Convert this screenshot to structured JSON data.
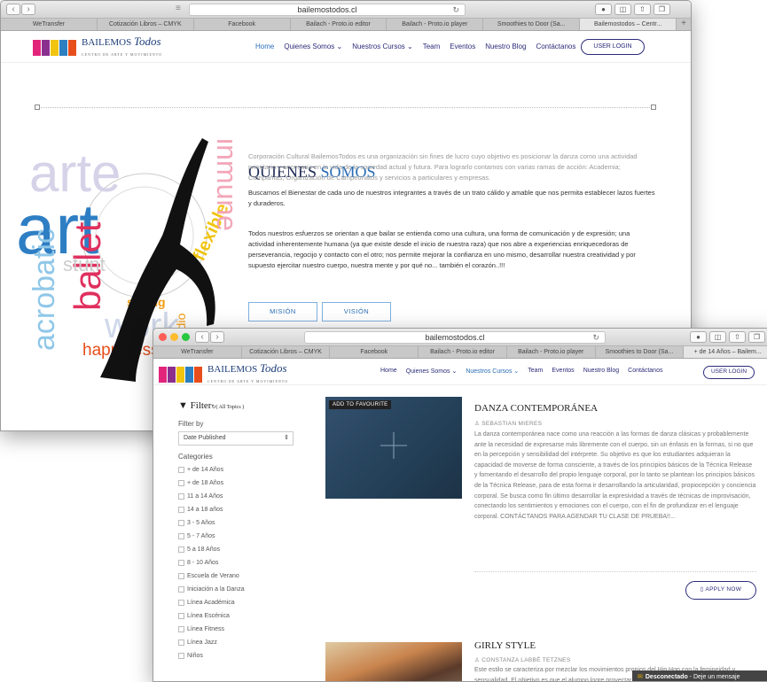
{
  "browser": {
    "url": "bailemostodos.cl",
    "tabs_w1": [
      "WeTransfer",
      "Cotización Libros – CMYK",
      "Facebook",
      "Bailach - Proto.io editor",
      "Bailach - Proto.io player",
      "Smoothies to Door (Sa...",
      "Bailemostodos – Centr..."
    ],
    "tabs_w2": [
      "WeTransfer",
      "Cotización Libros – CMYK",
      "Facebook",
      "Bailach - Proto.io editor",
      "Bailach - Proto.io player",
      "Smoothies to Door (Sa...",
      "+ de 14 Años – Bailem..."
    ]
  },
  "site": {
    "brand": "BAILEMOS",
    "brand_script": "Todos",
    "brand_sub": "CENTRO DE ARTE Y MOVIMIENTO",
    "menu": [
      "Home",
      "Quienes Somos",
      "Nuestros Cursos",
      "Team",
      "Eventos",
      "Nuestro Blog",
      "Contáctanos"
    ],
    "login": "USER LOGIN",
    "colors": {
      "navy": "#2b2b7a",
      "accent": "#2a6db5"
    }
  },
  "about": {
    "title_a": "QUIENES ",
    "title_b": "SOMOS",
    "p1": "Corporación Cultural BailemosTodos es una organización sin fines de lucro cuyo objetivo es posicionar la danza como una actividad prioritaria y necesaria en la vida de la sociedad actual y futura. Para lograrlo contamos con varias ramas de acción: Academia; Compañías; Organización de Campeonatos y servicios a particulares y empresas.",
    "p2": "Buscamos el Bienestar de cada uno de nuestros integrantes a través de un trato cálido y amable que nos permita establecer lazos fuertes y duraderos.",
    "p3": "Todos nuestros esfuerzos se orientan a que bailar se entienda como una cultura, una forma de comunicación y de expresión; una actividad inherentemente humana (ya que existe desde el inicio de nuestra raza) que nos abre a experiencias enriquecedoras de perseverancia, regocijo y contacto con el otro; nos permite mejorar la confianza en uno mismo, desarrollar nuestra creatividad y por supuesto ejercitar nuestro cuerpo, nuestra mente y por qué no... también el corazón..!!!",
    "btn_mision": "MISIÓN",
    "btn_vision": "VISIÓN",
    "hero_words": [
      "arte",
      "ballet",
      "acrobatic",
      "stunt",
      "strong",
      "studio",
      "flexible",
      "work",
      "happiness",
      "inmune"
    ]
  },
  "filter": {
    "title": "Filter",
    "all_topics": "( All Topics )",
    "filter_by": "Filter by",
    "select_value": "Date Published",
    "categories_label": "Categories",
    "categories": [
      "+ de 14 Años",
      "+ de 18 Años",
      "11 a 14 Años",
      "14 a 18 años",
      "3 - 5 Años",
      "5 - 7 Años",
      "5 a 18 Años",
      "8 - 10 Años",
      "Escuela de Verano",
      "Iniciación a la Danza",
      "Línea Académica",
      "Línea Escénica",
      "Línea Fitness",
      "Línea Jazz",
      "Niños"
    ]
  },
  "courses": [
    {
      "title": "DANZA CONTEMPORÁNEA",
      "author": "SEBASTIAN MIERES",
      "badge": "ADD TO FAVOURITE",
      "desc": "La danza contemporánea nace como una reacción a las formas de danza clásicas y probablemente ante la necesidad de expresarse más libremente con el cuerpo, sin un énfasis en la formas, si no que en la percepción y sensibilidad del intérprete. Su objetivo es que los estudiantes adquieran la capacidad de moverse de forma consciente, a través de los principios básicos de la Técnica Release y fomentando el desarrollo del propio lenguaje corporal, por lo tanto se plantean los principios básicos de la Técnica Release, para de esta forma ir desarrollando la articularidad, propiocepción y conciencia corporal. Se busca como fin último desarrollar la expresividad a través de técnicas de improvisación, conectando los sentimientos y emociones con el cuerpo, con el fin de profundizar en el lenguaje corporal. CONTÁCTANOS PARA AGENDAR TU CLASE DE PRUEBA!!...",
      "apply": "APPLY NOW"
    },
    {
      "title": "GIRLY STYLE",
      "author": "CONSTANZA LABBÉ TETZNES",
      "desc": "Este estilo se caracteriza por mezclar los movimientos propios del Hip Hop con la femineidad y sensualidad. El objetivo es que el alumno logre proyectar personalidad y actitud al bailar, dejando de lado la timidez disfrutando"
    }
  ],
  "chat": {
    "status": "Desconectado",
    "message": "Deje un mensaje"
  }
}
